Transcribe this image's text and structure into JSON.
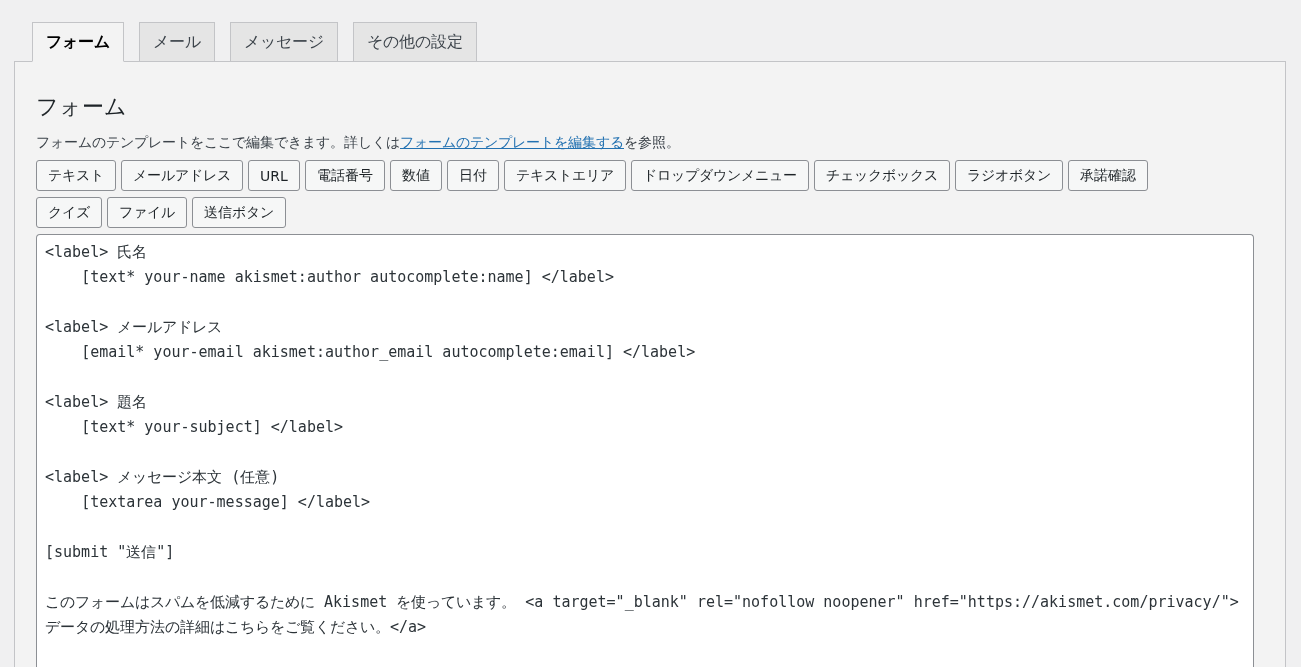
{
  "tabs": [
    {
      "label": "フォーム",
      "selected": true
    },
    {
      "label": "メール",
      "selected": false
    },
    {
      "label": "メッセージ",
      "selected": false
    },
    {
      "label": "その他の設定",
      "selected": false
    }
  ],
  "panel": {
    "heading": "フォーム",
    "description": {
      "before": "フォームのテンプレートをここで編集できます。詳しくは",
      "link": "フォームのテンプレートを編集する",
      "after": "を参照。"
    },
    "tag_buttons": [
      "テキスト",
      "メールアドレス",
      "URL",
      "電話番号",
      "数値",
      "日付",
      "テキストエリア",
      "ドロップダウンメニュー",
      "チェックボックス",
      "ラジオボタン",
      "承諾確認",
      "クイズ",
      "ファイル",
      "送信ボタン"
    ],
    "editor": {
      "value": "<label> 氏名\n    [text* your-name akismet:author autocomplete:name] </label>\n\n<label> メールアドレス\n    [email* your-email akismet:author_email autocomplete:email] </label>\n\n<label> 題名\n    [text* your-subject] </label>\n\n<label> メッセージ本文 (任意)\n    [textarea your-message] </label>\n\n[submit \"送信\"]\n\nこのフォームはスパムを低減するために Akismet を使っています。 <a target=\"_blank\" rel=\"nofollow noopener\" href=\"https://akismet.com/privacy/\">データの処理方法の詳細はこちらをご覧ください。</a>"
    }
  }
}
